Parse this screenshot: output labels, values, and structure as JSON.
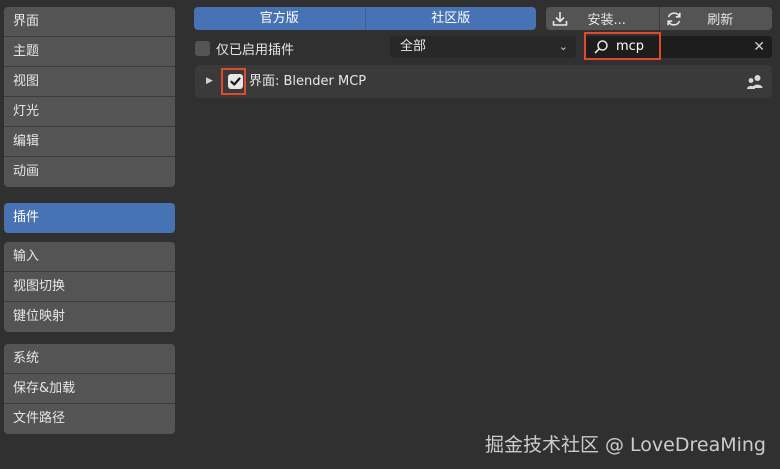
{
  "sidebar": {
    "groups": [
      [
        "界面",
        "主题",
        "视图",
        "灯光",
        "编辑",
        "动画"
      ],
      [
        "插件"
      ],
      [
        "输入",
        "视图切换",
        "键位映射"
      ],
      [
        "系统",
        "保存&加载",
        "文件路径"
      ]
    ],
    "active": "插件"
  },
  "tabs": {
    "official": "官方版",
    "community": "社区版"
  },
  "actions": {
    "install": "安装...",
    "refresh": "刷新"
  },
  "filter": {
    "enabled_only": "仅已启用插件",
    "category": "全部",
    "search_value": "mcp"
  },
  "addon": {
    "name": "界面: Blender MCP",
    "enabled": true
  },
  "watermark": "掘金技术社区 @ LoveDreaMing",
  "colors": {
    "accent": "#4772b3",
    "highlight": "#e0492c"
  }
}
